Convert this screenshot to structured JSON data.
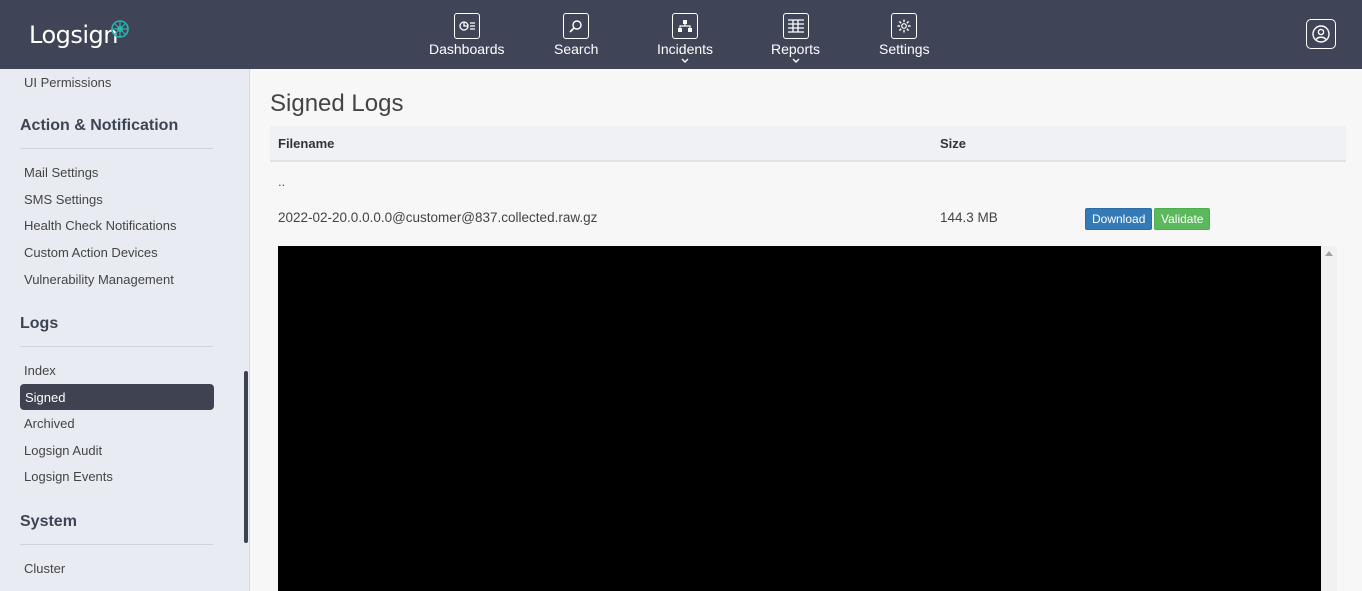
{
  "brand": {
    "logo_text": "Logsign"
  },
  "topnav": {
    "items": [
      {
        "label": "Dashboards",
        "icon": "dashboard-icon"
      },
      {
        "label": "Search",
        "icon": "search-icon"
      },
      {
        "label": "Incidents",
        "icon": "incidents-icon",
        "has_dropdown": true
      },
      {
        "label": "Reports",
        "icon": "reports-icon",
        "has_dropdown": true
      },
      {
        "label": "Settings",
        "icon": "settings-gear-icon"
      }
    ],
    "user_icon": "user-account-icon"
  },
  "sidebar": {
    "top_item": "UI Permissions",
    "sections": [
      {
        "title": "Action & Notification",
        "items": [
          "Mail Settings",
          "SMS Settings",
          "Health Check Notifications",
          "Custom Action Devices",
          "Vulnerability Management"
        ]
      },
      {
        "title": "Logs",
        "items": [
          "Index",
          "Signed",
          "Archived",
          "Logsign Audit",
          "Logsign Events"
        ],
        "active": "Signed"
      },
      {
        "title": "System",
        "items": [
          "Cluster"
        ]
      }
    ]
  },
  "main": {
    "title": "Signed Logs",
    "columns": {
      "filename": "Filename",
      "size": "Size"
    },
    "parent_link": "..",
    "rows": [
      {
        "filename": "2022-02-20.0.0.0.0@customer@837.collected.raw.gz",
        "size": "144.3 MB",
        "download_label": "Download",
        "validate_label": "Validate"
      }
    ]
  },
  "colors": {
    "topbar": "#3f4457",
    "sidebar": "#e8ebf2",
    "active_item": "#3f4250",
    "download_button": "#337ab7",
    "validate_button": "#5cb85c",
    "logo_accent": "#2bb5b0"
  }
}
